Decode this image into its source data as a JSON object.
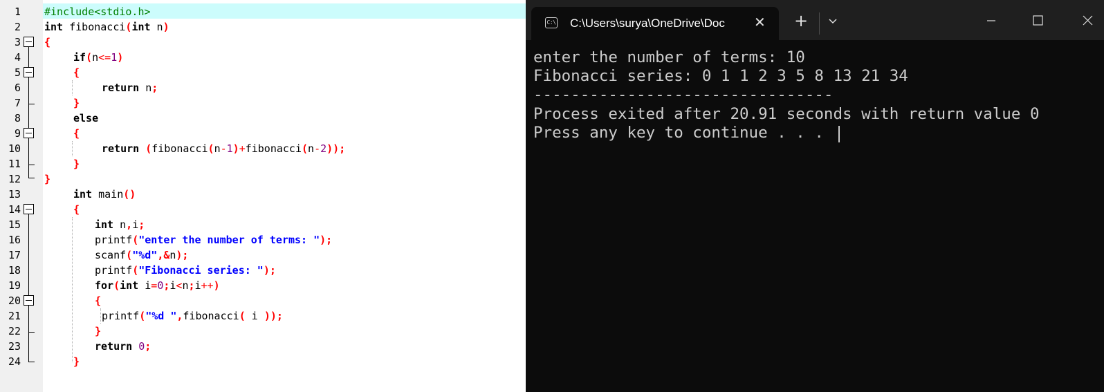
{
  "editor": {
    "line_numbers": [
      "1",
      "2",
      "3",
      "4",
      "5",
      "6",
      "7",
      "8",
      "9",
      "10",
      "11",
      "12",
      "13",
      "14",
      "15",
      "16",
      "17",
      "18",
      "19",
      "20",
      "21",
      "22",
      "23",
      "24"
    ],
    "tokens": {
      "l1_pp": "#include<stdio.h>",
      "l2_kw": "int",
      "l2_fn": " fibonacci",
      "l2_open": "(",
      "l2_kw2": "int",
      "l2_param": " n",
      "l2_close": ")",
      "l3_brace": "{",
      "l4_kw": "if",
      "l4_open": "(",
      "l4_var": "n",
      "l4_op": "<=",
      "l4_num": "1",
      "l4_close": ")",
      "l5_brace": "{",
      "l6_kw": "return",
      "l6_var": " n",
      "l6_semi": ";",
      "l7_brace": "}",
      "l8_kw": "else",
      "l9_brace": "{",
      "l10_kw": "return",
      "l10_sp": " ",
      "l10_p1": "(",
      "l10_f1": "fibonacci",
      "l10_p2": "(",
      "l10_v1": "n",
      "l10_m1": "-",
      "l10_n1": "1",
      "l10_p3": ")",
      "l10_plus": "+",
      "l10_f2": "fibonacci",
      "l10_p4": "(",
      "l10_v2": "n",
      "l10_m2": "-",
      "l10_n2": "2",
      "l10_p5": "))",
      "l10_semi": ";",
      "l11_brace": "}",
      "l12_brace": "}",
      "l13_kw": "int",
      "l13_fn": " main",
      "l13_paren": "()",
      "l14_brace": "{",
      "l15_kw": "int",
      "l15_v": " n",
      "l15_c": ",",
      "l15_i": "i",
      "l15_semi": ";",
      "l16_fn": "printf",
      "l16_open": "(",
      "l16_str": "\"enter the number of terms: \"",
      "l16_close": ");",
      "l17_fn": "scanf",
      "l17_open": "(",
      "l17_str": "\"%d\"",
      "l17_mid": ",&",
      "l17_v": "n",
      "l17_close": ");",
      "l18_fn": "printf",
      "l18_open": "(",
      "l18_str": "\"Fibonacci series: \"",
      "l18_close": ");",
      "l19_kw": "for",
      "l19_open": "(",
      "l19_kw2": "int",
      "l19_v1": " i",
      "l19_eq": "=",
      "l19_n0": "0",
      "l19_s1": ";",
      "l19_v2": "i",
      "l19_lt": "<",
      "l19_v3": "n",
      "l19_s2": ";",
      "l19_v4": "i",
      "l19_pp": "++",
      "l19_close": ")",
      "l20_brace": "{",
      "l21_fn": "printf",
      "l21_open": "(",
      "l21_str": "\"%d \"",
      "l21_c": ",",
      "l21_f": "fibonacci",
      "l21_open2": "(",
      "l21_v": " i ",
      "l21_close": "));",
      "l22_brace": "}",
      "l23_kw": "return",
      "l23_num": " 0",
      "l23_semi": ";",
      "l24_brace": "}"
    }
  },
  "terminal": {
    "tab_title": "C:\\Users\\surya\\OneDrive\\Doc",
    "tab_icon_text": "C:\\",
    "tab_icon": "terminal-icon",
    "close_tab_glyph": "✕",
    "new_tab_glyph": "+",
    "dropdown_icon": "chevron-down-icon",
    "minimize_icon": "minimize-icon",
    "maximize_icon": "maximize-icon",
    "close_icon": "close-icon",
    "output": [
      "enter the number of terms: 10",
      "Fibonacci series: 0 1 1 2 3 5 8 13 21 34",
      "--------------------------------",
      "Process exited after 20.91 seconds with return value 0",
      "Press any key to continue . . ."
    ]
  },
  "colors": {
    "keyword": "#000000",
    "brace": "#ff0000",
    "number": "#800080",
    "string": "#0000ff",
    "preprocessor": "#008000",
    "current_line": "#ccfcfc",
    "gutter": "#f0f0f0",
    "terminal_bg": "#0c0c0c",
    "terminal_text": "#cccccc"
  }
}
